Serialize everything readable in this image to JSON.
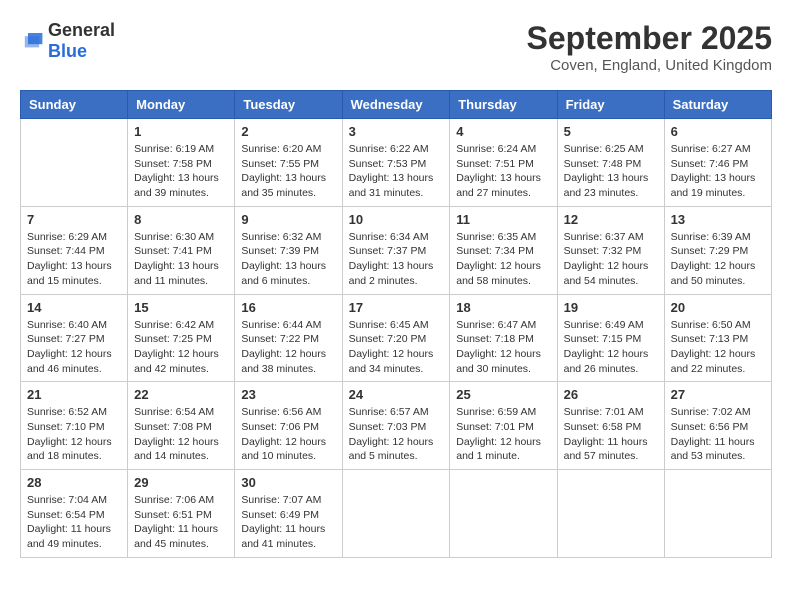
{
  "logo": {
    "general": "General",
    "blue": "Blue"
  },
  "title": "September 2025",
  "location": "Coven, England, United Kingdom",
  "weekdays": [
    "Sunday",
    "Monday",
    "Tuesday",
    "Wednesday",
    "Thursday",
    "Friday",
    "Saturday"
  ],
  "weeks": [
    [
      {
        "day": "",
        "info": ""
      },
      {
        "day": "1",
        "info": "Sunrise: 6:19 AM\nSunset: 7:58 PM\nDaylight: 13 hours\nand 39 minutes."
      },
      {
        "day": "2",
        "info": "Sunrise: 6:20 AM\nSunset: 7:55 PM\nDaylight: 13 hours\nand 35 minutes."
      },
      {
        "day": "3",
        "info": "Sunrise: 6:22 AM\nSunset: 7:53 PM\nDaylight: 13 hours\nand 31 minutes."
      },
      {
        "day": "4",
        "info": "Sunrise: 6:24 AM\nSunset: 7:51 PM\nDaylight: 13 hours\nand 27 minutes."
      },
      {
        "day": "5",
        "info": "Sunrise: 6:25 AM\nSunset: 7:48 PM\nDaylight: 13 hours\nand 23 minutes."
      },
      {
        "day": "6",
        "info": "Sunrise: 6:27 AM\nSunset: 7:46 PM\nDaylight: 13 hours\nand 19 minutes."
      }
    ],
    [
      {
        "day": "7",
        "info": "Sunrise: 6:29 AM\nSunset: 7:44 PM\nDaylight: 13 hours\nand 15 minutes."
      },
      {
        "day": "8",
        "info": "Sunrise: 6:30 AM\nSunset: 7:41 PM\nDaylight: 13 hours\nand 11 minutes."
      },
      {
        "day": "9",
        "info": "Sunrise: 6:32 AM\nSunset: 7:39 PM\nDaylight: 13 hours\nand 6 minutes."
      },
      {
        "day": "10",
        "info": "Sunrise: 6:34 AM\nSunset: 7:37 PM\nDaylight: 13 hours\nand 2 minutes."
      },
      {
        "day": "11",
        "info": "Sunrise: 6:35 AM\nSunset: 7:34 PM\nDaylight: 12 hours\nand 58 minutes."
      },
      {
        "day": "12",
        "info": "Sunrise: 6:37 AM\nSunset: 7:32 PM\nDaylight: 12 hours\nand 54 minutes."
      },
      {
        "day": "13",
        "info": "Sunrise: 6:39 AM\nSunset: 7:29 PM\nDaylight: 12 hours\nand 50 minutes."
      }
    ],
    [
      {
        "day": "14",
        "info": "Sunrise: 6:40 AM\nSunset: 7:27 PM\nDaylight: 12 hours\nand 46 minutes."
      },
      {
        "day": "15",
        "info": "Sunrise: 6:42 AM\nSunset: 7:25 PM\nDaylight: 12 hours\nand 42 minutes."
      },
      {
        "day": "16",
        "info": "Sunrise: 6:44 AM\nSunset: 7:22 PM\nDaylight: 12 hours\nand 38 minutes."
      },
      {
        "day": "17",
        "info": "Sunrise: 6:45 AM\nSunset: 7:20 PM\nDaylight: 12 hours\nand 34 minutes."
      },
      {
        "day": "18",
        "info": "Sunrise: 6:47 AM\nSunset: 7:18 PM\nDaylight: 12 hours\nand 30 minutes."
      },
      {
        "day": "19",
        "info": "Sunrise: 6:49 AM\nSunset: 7:15 PM\nDaylight: 12 hours\nand 26 minutes."
      },
      {
        "day": "20",
        "info": "Sunrise: 6:50 AM\nSunset: 7:13 PM\nDaylight: 12 hours\nand 22 minutes."
      }
    ],
    [
      {
        "day": "21",
        "info": "Sunrise: 6:52 AM\nSunset: 7:10 PM\nDaylight: 12 hours\nand 18 minutes."
      },
      {
        "day": "22",
        "info": "Sunrise: 6:54 AM\nSunset: 7:08 PM\nDaylight: 12 hours\nand 14 minutes."
      },
      {
        "day": "23",
        "info": "Sunrise: 6:56 AM\nSunset: 7:06 PM\nDaylight: 12 hours\nand 10 minutes."
      },
      {
        "day": "24",
        "info": "Sunrise: 6:57 AM\nSunset: 7:03 PM\nDaylight: 12 hours\nand 5 minutes."
      },
      {
        "day": "25",
        "info": "Sunrise: 6:59 AM\nSunset: 7:01 PM\nDaylight: 12 hours\nand 1 minute."
      },
      {
        "day": "26",
        "info": "Sunrise: 7:01 AM\nSunset: 6:58 PM\nDaylight: 11 hours\nand 57 minutes."
      },
      {
        "day": "27",
        "info": "Sunrise: 7:02 AM\nSunset: 6:56 PM\nDaylight: 11 hours\nand 53 minutes."
      }
    ],
    [
      {
        "day": "28",
        "info": "Sunrise: 7:04 AM\nSunset: 6:54 PM\nDaylight: 11 hours\nand 49 minutes."
      },
      {
        "day": "29",
        "info": "Sunrise: 7:06 AM\nSunset: 6:51 PM\nDaylight: 11 hours\nand 45 minutes."
      },
      {
        "day": "30",
        "info": "Sunrise: 7:07 AM\nSunset: 6:49 PM\nDaylight: 11 hours\nand 41 minutes."
      },
      {
        "day": "",
        "info": ""
      },
      {
        "day": "",
        "info": ""
      },
      {
        "day": "",
        "info": ""
      },
      {
        "day": "",
        "info": ""
      }
    ]
  ]
}
